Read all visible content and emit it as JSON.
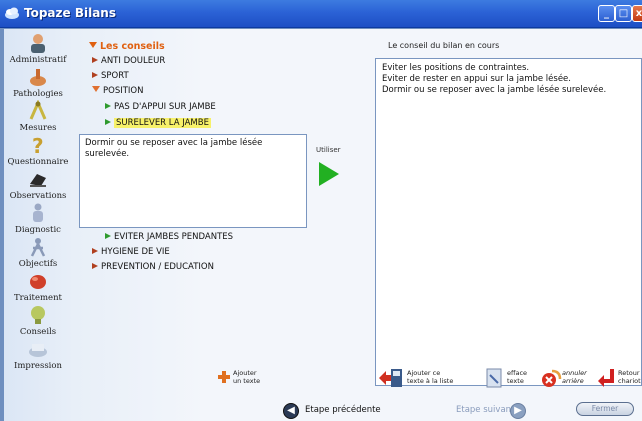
{
  "window": {
    "title": "Topaze Bilans"
  },
  "nav": [
    {
      "label": "Administratif",
      "icon": "person-icon"
    },
    {
      "label": "Pathologies",
      "icon": "pathology-icon"
    },
    {
      "label": "Mesures",
      "icon": "measure-icon"
    },
    {
      "label": "Questionnaire",
      "icon": "question-icon"
    },
    {
      "label": "Observations",
      "icon": "observation-icon"
    },
    {
      "label": "Diagnostic",
      "icon": "diagnostic-icon"
    },
    {
      "label": "Objectifs",
      "icon": "objectives-icon"
    },
    {
      "label": "Traitement",
      "icon": "treatment-icon"
    },
    {
      "label": "Conseils",
      "icon": "advice-icon"
    },
    {
      "label": "Impression",
      "icon": "print-icon"
    }
  ],
  "tree": {
    "root": "Les conseils",
    "items": [
      {
        "label": "ANTI DOULEUR",
        "level": 1,
        "state": "collapsed"
      },
      {
        "label": "SPORT",
        "level": 1,
        "state": "collapsed"
      },
      {
        "label": "POSITION",
        "level": 1,
        "state": "expanded"
      },
      {
        "label": "PAS D'APPUI SUR JAMBE",
        "level": 2,
        "state": "leaf"
      },
      {
        "label": "SURELEVER LA JAMBE",
        "level": 2,
        "state": "selected"
      },
      {
        "label": "EVITER JAMBES PENDANTES",
        "level": 2,
        "state": "leaf"
      },
      {
        "label": "HYGIENE DE VIE",
        "level": 1,
        "state": "collapsed"
      },
      {
        "label": "PREVENTION / EDUCATION",
        "level": 1,
        "state": "collapsed"
      }
    ]
  },
  "preview_text": "Dormir ou se reposer avec la jambe lésée surelevée.",
  "use_label": "Utiliser",
  "advice": {
    "label": "Le conseil du bilan en cours",
    "lines": [
      "Eviter les positions de contraintes.",
      "Eviter de rester en appui sur la jambe lésée.",
      "Dormir ou se reposer avec la jambe lésée surelevée."
    ]
  },
  "toolbar": {
    "add_text_1": "Ajouter",
    "add_text_2": "un texte",
    "add_list_1": "Ajouter ce",
    "add_list_2": "texte à la liste",
    "erase_1": "efface",
    "erase_2": "texte",
    "cancel_1": "annuler",
    "cancel_2": "arrière",
    "return_1": "Retour",
    "return_2": "chariot"
  },
  "footer": {
    "prev": "Etape précédente",
    "next": "Etape suivante",
    "close": "Fermer"
  },
  "colors": {
    "titlebar": "#2b62d6",
    "accent": "#e06010",
    "highlight": "#f7f16a",
    "go": "#22b022"
  }
}
